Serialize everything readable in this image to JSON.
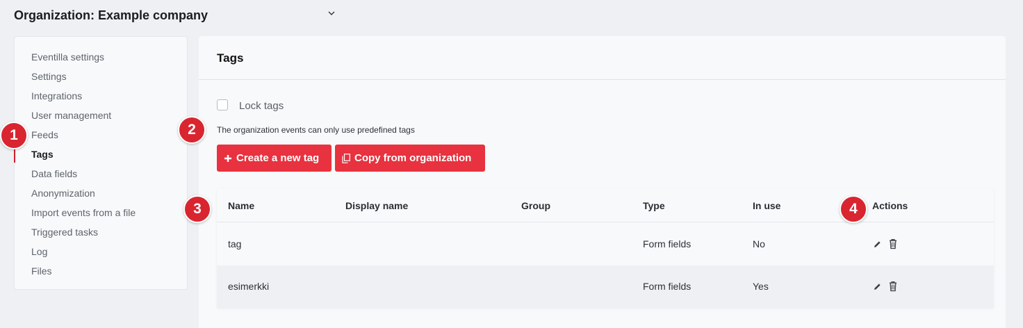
{
  "org": {
    "title": "Organization: Example company"
  },
  "sidebar": {
    "items": [
      {
        "label": "Eventilla settings"
      },
      {
        "label": "Settings"
      },
      {
        "label": "Integrations"
      },
      {
        "label": "User management"
      },
      {
        "label": "Feeds"
      },
      {
        "label": "Tags"
      },
      {
        "label": "Data fields"
      },
      {
        "label": "Anonymization"
      },
      {
        "label": "Import events from a file"
      },
      {
        "label": "Triggered tasks"
      },
      {
        "label": "Log"
      },
      {
        "label": "Files"
      }
    ],
    "active": "Tags"
  },
  "main": {
    "title": "Tags",
    "lock_label": "Lock tags",
    "lock_checked": false,
    "help_text": "The organization events can only use predefined tags",
    "create_button": "Create a new tag",
    "copy_button": "Copy from organization"
  },
  "table": {
    "headers": {
      "name": "Name",
      "display_name": "Display name",
      "group": "Group",
      "type": "Type",
      "in_use": "In use",
      "actions": "Actions"
    },
    "rows": [
      {
        "name": "tag",
        "display_name": "",
        "group": "",
        "type": "Form fields",
        "in_use": "No"
      },
      {
        "name": "esimerkki",
        "display_name": "",
        "group": "",
        "type": "Form fields",
        "in_use": "Yes"
      }
    ]
  },
  "badges": [
    "1",
    "2",
    "3",
    "4"
  ],
  "colors": {
    "accent": "#e8323f",
    "badge": "#d9252f",
    "active_bar": "#cf1f2e"
  }
}
